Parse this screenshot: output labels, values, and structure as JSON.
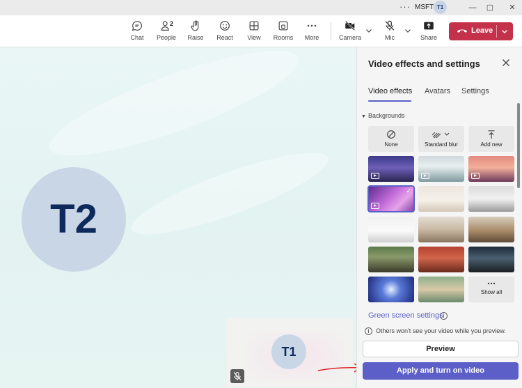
{
  "titlebar": {
    "more_glyph": "···",
    "org": "MSFT",
    "avatar_initials": "T1",
    "minimize_glyph": "—",
    "maximize_glyph": "▢",
    "close_glyph": "✕"
  },
  "toolbar": {
    "chat": "Chat",
    "people": "People",
    "people_count": "2",
    "raise": "Raise",
    "react": "React",
    "view": "View",
    "rooms": "Rooms",
    "more": "More",
    "camera": "Camera",
    "mic": "Mic",
    "share": "Share",
    "leave": "Leave"
  },
  "stage": {
    "remote_initials": "T2",
    "self_initials": "T1"
  },
  "panel": {
    "title": "Video effects and settings",
    "tabs": [
      "Video effects",
      "Avatars",
      "Settings"
    ],
    "section": "Backgrounds",
    "options": [
      "None",
      "Standard blur",
      "Add new"
    ],
    "show_all": "Show all",
    "green_screen": "Green screen settings",
    "note": "Others won't see your video while you preview.",
    "preview": "Preview",
    "apply": "Apply and turn on video"
  },
  "colors": {
    "accent": "#5b5fc7",
    "leave": "#c4314b"
  }
}
